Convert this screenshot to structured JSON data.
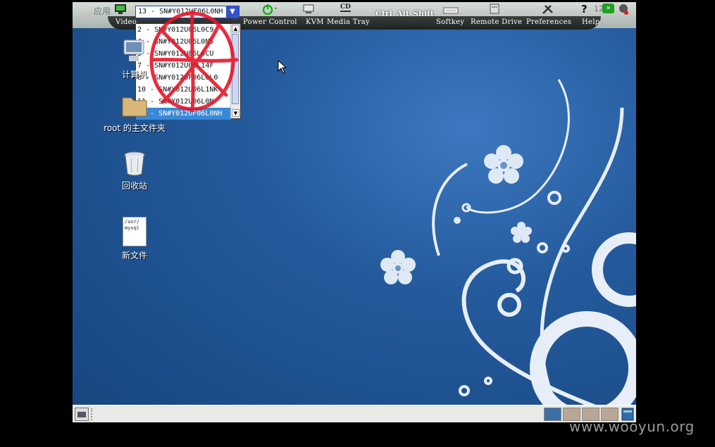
{
  "kvm_toolbar": {
    "buttons": [
      {
        "label": "Video"
      },
      {
        "label": "Power Control"
      },
      {
        "label": "KVM"
      },
      {
        "label": "Media Tray"
      },
      {
        "label": "Softkey"
      },
      {
        "label": "Remote Drive"
      },
      {
        "label": "Preferences"
      },
      {
        "label": "Help"
      }
    ],
    "cd_label": "CD",
    "keys": [
      "Ctrl",
      "Alt",
      "Shift"
    ],
    "clock_fragment": "12",
    "gnome_menu_text": "应用"
  },
  "server_select": {
    "value": "13 - SN#Y012UF06L0NH",
    "options": [
      "2 - SN#Y012U06L0C9",
      "4 - SN#Y012U06L0N5",
      "5 - SN#Y012U06L0CU",
      "7 - SN#Y012U06L14F",
      "8 - SN#Y012UF06L0L0",
      "10 - SN#Y012U06L1NK",
      "11 - SN#Y012U06L0N",
      "13 - SN#Y012UF06L0NH"
    ],
    "selected_index": 7
  },
  "desktop": {
    "icons": [
      {
        "label": "计算机"
      },
      {
        "label": "root 的主文件夹"
      },
      {
        "label": "回收站"
      },
      {
        "label": "新文件",
        "file_preview": "/usr/\nmysql"
      }
    ]
  },
  "watermark": "www.wooyun.org",
  "colors": {
    "desktop_blue": "#245a9c",
    "dropdown_border": "#2444c8",
    "selection": "#3a89d8",
    "annotation_red": "#e8152a"
  }
}
